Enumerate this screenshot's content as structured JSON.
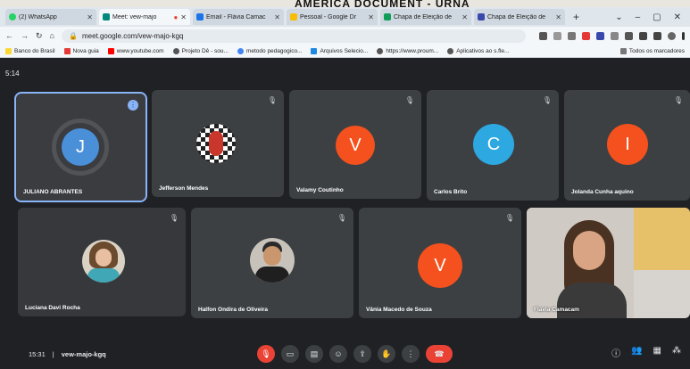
{
  "photo_caption": "AMERICA DOCUMENT - URNA",
  "browser": {
    "tabs": [
      {
        "label": "(2) WhatsApp",
        "color": "#25d366",
        "active": false
      },
      {
        "label": "Meet: vew-majo",
        "color": "#00897b",
        "active": true
      },
      {
        "label": "Email - Flávia Camac",
        "color": "#1a73e8",
        "active": false
      },
      {
        "label": "Pessoal - Google Dr",
        "color": "#fbbc04",
        "active": false
      },
      {
        "label": "Chapa de Eleição de",
        "color": "#0f9d58",
        "active": false
      },
      {
        "label": "Chapa de Eleição de",
        "color": "#3949ab",
        "active": false
      }
    ],
    "new_tab": "+",
    "url": "meet.google.com/vew-majo-kgq",
    "bookmarks": [
      {
        "label": "Banco do Brasil",
        "color": "#fdd835"
      },
      {
        "label": "Nova guia",
        "color": "#e53935"
      },
      {
        "label": "www.youtube.com",
        "color": "#ff0000"
      },
      {
        "label": "Projeto Dê - sou...",
        "color": "#555555"
      },
      {
        "label": "metodo pedagogico...",
        "color": "#4285f4"
      },
      {
        "label": "Arquivos Selecio...",
        "color": "#1e88e5"
      },
      {
        "label": "https://www.proum...",
        "color": "#555555"
      },
      {
        "label": "Aplicativos ao s.fle...",
        "color": "#555555"
      }
    ],
    "bookmarks_right": "Todos os marcadores"
  },
  "meet": {
    "top_time": "5:14",
    "participants": [
      {
        "name": "JULIANO ABRANTES",
        "initial": "J",
        "color": "#4a90d9",
        "speaking": true,
        "type": "initial"
      },
      {
        "name": "Jefferson Mendes",
        "initial": "",
        "color": "",
        "speaking": false,
        "type": "photo"
      },
      {
        "name": "Valamy Coutinho",
        "initial": "V",
        "color": "#f4511e",
        "speaking": false,
        "type": "initial"
      },
      {
        "name": "Carlos Brito",
        "initial": "C",
        "color": "#2ea8e0",
        "speaking": false,
        "type": "initial"
      },
      {
        "name": "Jolanda Cunha aquino",
        "initial": "I",
        "color": "#f4511e",
        "speaking": false,
        "type": "initial"
      },
      {
        "name": "Luciana Davi Rocha",
        "initial": "",
        "color": "",
        "speaking": false,
        "type": "photo"
      },
      {
        "name": "Halfon Ondira de Oliveira",
        "initial": "",
        "color": "",
        "speaking": false,
        "type": "photo"
      },
      {
        "name": "Vânia Macedo de Souza",
        "initial": "V",
        "color": "#f4511e",
        "speaking": false,
        "type": "initial"
      },
      {
        "name": "Flavia Camacam",
        "initial": "",
        "color": "",
        "speaking": false,
        "type": "video"
      }
    ],
    "bottom_time": "15:31",
    "meeting_code": "vew-majo-kgq"
  }
}
